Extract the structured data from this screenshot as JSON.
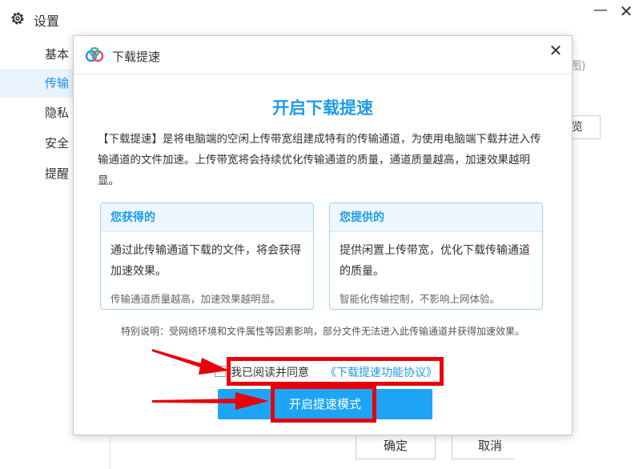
{
  "settings": {
    "title": "设置",
    "sidebar": [
      {
        "label": "基本",
        "active": false
      },
      {
        "label": "传输",
        "active": true
      },
      {
        "label": "隐私",
        "active": false
      },
      {
        "label": "安全",
        "active": false
      },
      {
        "label": "提醒",
        "active": false
      }
    ],
    "right_fragment_text": "图)",
    "right_fragment_button": "览",
    "ok_label": "确定",
    "cancel_label": "取消"
  },
  "dialog": {
    "title": "下载提速",
    "heading": "开启下载提速",
    "description": "【下载提速】是将电脑端的空闲上传带宽组建成特有的传输通道，为使用电脑端下载并进入传输通道的文件加速。上传带宽将会持续优化传输通道的质量，通道质量越高，加速效果越明显。",
    "cards": {
      "left": {
        "header": "您获得的",
        "body": "通过此传输通道下载的文件，将会获得加速效果。",
        "footer": "传输通道质量越高，加速效果越明显。"
      },
      "right": {
        "header": "您提供的",
        "body": "提供闲置上传带宽，优化下载传输通道的质量。",
        "footer": "智能化传输控制，不影响上网体验。"
      }
    },
    "note": "特别说明：受网络环境和文件属性等因素影响，部分文件无法进入此传输通道并获得加速效果。",
    "agree_text": "我已阅读并同意",
    "agree_link": "《下载提速功能协议》",
    "enable_button": "开启提速模式"
  },
  "colors": {
    "accent": "#1e9be8",
    "button": "#1ea4f5",
    "annotation_red": "#e8000b"
  }
}
